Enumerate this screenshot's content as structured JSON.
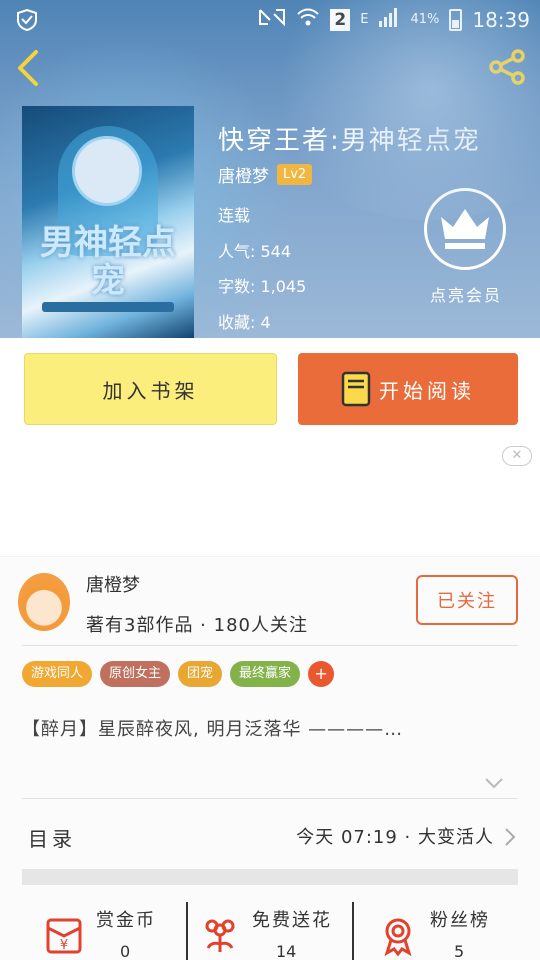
{
  "statusbar": {
    "sim": "2",
    "net": "E",
    "battery": "41%",
    "time": "18:39"
  },
  "book": {
    "title": "快穿王者:男神轻点宠",
    "author": "唐橙梦",
    "level": "Lv2",
    "status": "连载",
    "popularity": "人气: 544",
    "word_count": "字数: 1,045",
    "favorites": "收藏: 4",
    "cover_art_text": "男神轻点宠"
  },
  "vip": {
    "label": "点亮会员"
  },
  "actions": {
    "add_shelf": "加入书架",
    "start_reading": "开始阅读"
  },
  "ad": {
    "close": "✕"
  },
  "author_card": {
    "name": "唐橙梦",
    "stats": "著有3部作品 · 180人关注",
    "follow_label": "已关注",
    "tags": [
      {
        "label": "游戏同人",
        "color": "#f0a832"
      },
      {
        "label": "原创女主",
        "color": "#c0705f"
      },
      {
        "label": "团宠",
        "color": "#e8a632"
      },
      {
        "label": "最终赢家",
        "color": "#84b24a"
      }
    ],
    "add_tag": "+",
    "intro": "【醉月】星辰醉夜风, 明月泛落华 ————…"
  },
  "toc": {
    "label": "目录",
    "latest": "今天 07:19 · 大变活人"
  },
  "bottom": {
    "reward": {
      "label": "赏金币",
      "value": "0"
    },
    "flowers": {
      "label": "免费送花",
      "value": "14"
    },
    "fans": {
      "label": "粉丝榜",
      "value": "5"
    }
  },
  "colors": {
    "accent_orange": "#ea6c3a",
    "shelf_yellow": "#fbee7c",
    "icon_red": "#e0422e"
  }
}
